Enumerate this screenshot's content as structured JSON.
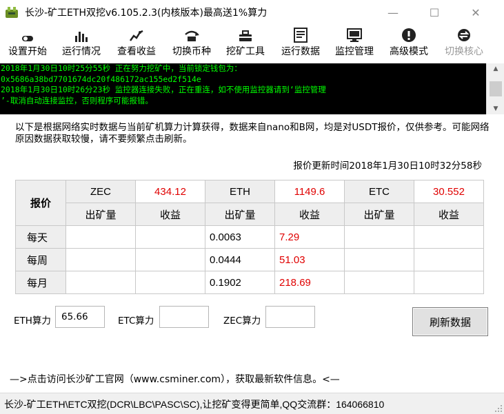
{
  "window": {
    "title": "长沙-矿工ETH双挖v6.105.2.3(内核版本)最高送1%算力",
    "minimize": "—",
    "maximize": "☐",
    "close": "✕"
  },
  "toolbar": {
    "items": [
      {
        "label": "设置开始",
        "icon": "toggle-icon"
      },
      {
        "label": "运行情况",
        "icon": "bar-chart-icon"
      },
      {
        "label": "查看收益",
        "icon": "line-chart-icon"
      },
      {
        "label": "切换币种",
        "icon": "switch-icon"
      },
      {
        "label": "挖矿工具",
        "icon": "tools-icon"
      },
      {
        "label": "运行数据",
        "icon": "document-icon"
      },
      {
        "label": "监控管理",
        "icon": "monitor-icon"
      },
      {
        "label": "高级模式",
        "icon": "alert-icon"
      },
      {
        "label": "切换核心",
        "icon": "kernel-icon",
        "disabled": true
      }
    ]
  },
  "log": {
    "lines": [
      "2018年1月30日10时25分55秒 正在努力挖矿中，当前锁定钱包为：",
      "0x5686a38bd7701674dc20f486172ac155ed2f514e",
      "2018年1月30日10时26分23秒 监控器连接失败，正在重连，如不使用监控器请到‘监控管理",
      "’-取消自动连接监控，否则程序可能报错。"
    ],
    "color": "#00ff00"
  },
  "notice": "以下是根据网络实时数据与当前矿机算力计算获得，数据来自nano和B网，均是对USDT报价，仅供参考。可能网络原因数据获取较慢，请不要频繁点击刷新。",
  "update_time": "报价更新时间2018年1月30日10时32分58秒",
  "price_table": {
    "corner": "报价",
    "coins": [
      {
        "name": "ZEC",
        "price": "434.12"
      },
      {
        "name": "ETH",
        "price": "1149.6"
      },
      {
        "name": "ETC",
        "price": "30.552"
      }
    ],
    "sub_headers": [
      "出矿量",
      "收益",
      "出矿量",
      "收益",
      "出矿量",
      "收益"
    ],
    "rows": [
      {
        "label": "每天",
        "cells": [
          "",
          "",
          "0.0063",
          "7.29",
          "",
          ""
        ]
      },
      {
        "label": "每周",
        "cells": [
          "",
          "",
          "0.0444",
          "51.03",
          "",
          ""
        ]
      },
      {
        "label": "每月",
        "cells": [
          "",
          "",
          "0.1902",
          "218.69",
          "",
          ""
        ]
      }
    ],
    "accent": "#e00000"
  },
  "hashrate": {
    "eth_label": "ETH算力",
    "eth_value": "65.66",
    "etc_label": "ETC算力",
    "etc_value": "",
    "zec_label": "ZEC算力",
    "zec_value": ""
  },
  "refresh_button": "刷新数据",
  "website_link": "—>点击访问长沙矿工官网（www.csminer.com），获取最新软件信息。<—",
  "status_bar": "长沙-矿工ETH\\ETC双挖(DCR\\LBC\\PASC\\SC),让挖矿变得更简单,QQ交流群：164066810"
}
